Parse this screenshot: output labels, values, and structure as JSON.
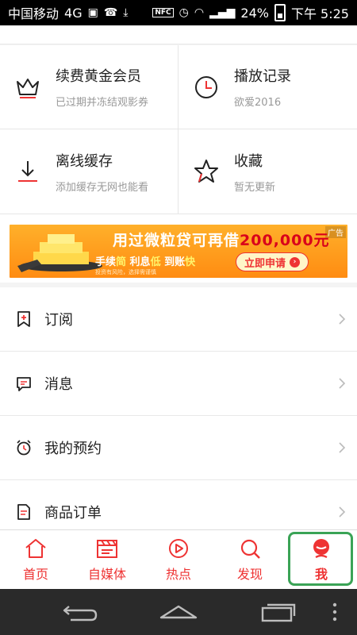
{
  "status_bar": {
    "carrier": "中国移动",
    "network": "4G",
    "battery_percent": "24%",
    "time": "下午 5:25",
    "nfc": "NFC"
  },
  "grid": [
    {
      "title": "续费黄金会员",
      "subtitle": "已过期并冻结观影券",
      "icon": "crown-icon"
    },
    {
      "title": "播放记录",
      "subtitle": "欲爱2016",
      "icon": "clock-icon"
    },
    {
      "title": "离线缓存",
      "subtitle": "添加缓存无网也能看",
      "icon": "download-icon"
    },
    {
      "title": "收藏",
      "subtitle": "暂无更新",
      "icon": "star-icon"
    }
  ],
  "ad": {
    "tag": "广告",
    "headline": "用过微粒贷可再借",
    "amount": "200,000元",
    "line2_a": "手续",
    "line2_b": "简",
    "line2_c": " 利息",
    "line2_d": "低",
    "line2_e": " 到账",
    "line2_f": "快",
    "small": "投资有风险，选择需谨慎",
    "button": "立即申请"
  },
  "list": [
    {
      "label": "订阅",
      "icon": "bookmark-icon"
    },
    {
      "label": "消息",
      "icon": "message-icon"
    },
    {
      "label": "我的预约",
      "icon": "alarm-icon"
    },
    {
      "label": "商品订单",
      "icon": "order-icon"
    }
  ],
  "tabs": [
    {
      "label": "首页",
      "icon": "home-icon"
    },
    {
      "label": "自媒体",
      "icon": "clapper-icon"
    },
    {
      "label": "热点",
      "icon": "play-icon"
    },
    {
      "label": "发现",
      "icon": "discover-icon"
    },
    {
      "label": "我",
      "icon": "profile-icon",
      "active": true
    }
  ],
  "colors": {
    "accent": "#e33333",
    "highlight": "#3aa356"
  }
}
